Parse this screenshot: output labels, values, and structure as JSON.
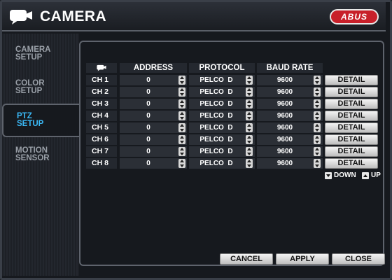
{
  "header": {
    "title": "CAMERA",
    "logo_text": "ABUS",
    "camera_icon": "camera-icon",
    "colors": {
      "logo_bg": "#c8202a",
      "active_accent": "#3ab8f5",
      "panel_border": "#5e636c"
    }
  },
  "sidebar": {
    "items": [
      {
        "line1": "CAMERA",
        "line2": "SETUP",
        "active": false
      },
      {
        "line1": "COLOR",
        "line2": "SETUP",
        "active": false
      },
      {
        "line1": "PTZ",
        "line2": "SETUP",
        "active": true
      },
      {
        "line1": "MOTION",
        "line2": "SENSOR",
        "active": false
      }
    ]
  },
  "table": {
    "columns": {
      "channel_icon": "camera-icon",
      "address": "ADDRESS",
      "protocol": "PROTOCOL",
      "baud_rate": "BAUD RATE"
    },
    "rows": [
      {
        "channel": "CH 1",
        "address": "0",
        "protocol": "PELCO  D",
        "baud_rate": "9600",
        "detail": "DETAIL"
      },
      {
        "channel": "CH 2",
        "address": "0",
        "protocol": "PELCO  D",
        "baud_rate": "9600",
        "detail": "DETAIL"
      },
      {
        "channel": "CH 3",
        "address": "0",
        "protocol": "PELCO  D",
        "baud_rate": "9600",
        "detail": "DETAIL"
      },
      {
        "channel": "CH 4",
        "address": "0",
        "protocol": "PELCO  D",
        "baud_rate": "9600",
        "detail": "DETAIL"
      },
      {
        "channel": "CH 5",
        "address": "0",
        "protocol": "PELCO  D",
        "baud_rate": "9600",
        "detail": "DETAIL"
      },
      {
        "channel": "CH 6",
        "address": "0",
        "protocol": "PELCO  D",
        "baud_rate": "9600",
        "detail": "DETAIL"
      },
      {
        "channel": "CH 7",
        "address": "0",
        "protocol": "PELCO  D",
        "baud_rate": "9600",
        "detail": "DETAIL"
      },
      {
        "channel": "CH 8",
        "address": "0",
        "protocol": "PELCO  D",
        "baud_rate": "9600",
        "detail": "DETAIL"
      }
    ]
  },
  "paging": {
    "down_label": "DOWN",
    "up_label": "UP"
  },
  "footer": {
    "cancel_label": "CANCEL",
    "apply_label": "APPLY",
    "close_label": "CLOSE"
  }
}
